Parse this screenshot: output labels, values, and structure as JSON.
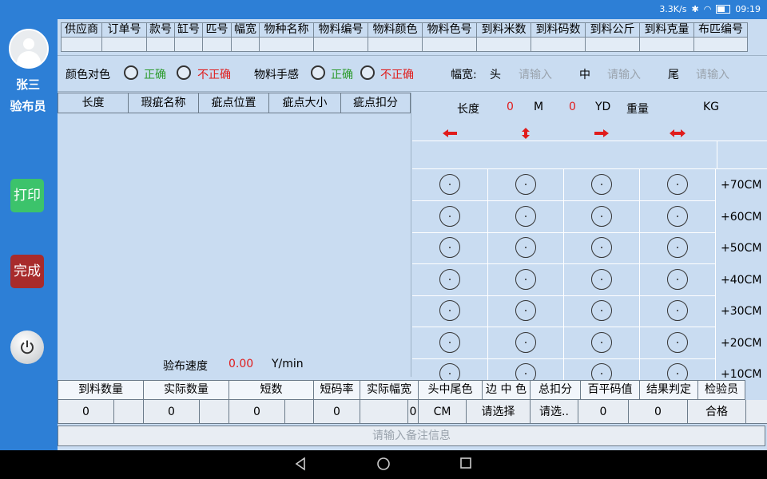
{
  "status": {
    "speed": "3.3K/s",
    "time": "09:19"
  },
  "user": {
    "name": "张三",
    "role": "验布员"
  },
  "sidebar": {
    "print_label": "打印",
    "done_label": "完成"
  },
  "header_columns": [
    "供应商",
    "订单号",
    "款号",
    "缸号",
    "匹号",
    "幅宽",
    "物种名称",
    "物料编号",
    "物料颜色",
    "物料色号",
    "到料米数",
    "到料码数",
    "到料公斤",
    "到料克量",
    "布匹编号"
  ],
  "checks": {
    "color_label": "颜色对色",
    "feel_label": "物料手感",
    "correct": "正确",
    "incorrect": "不正确",
    "width_label": "幅宽:",
    "head": "头",
    "middle": "中",
    "tail": "尾",
    "placeholder": "请输入"
  },
  "defect_table": {
    "columns": [
      "长度",
      "瑕疵名称",
      "疵点位置",
      "疵点大小",
      "疵点扣分"
    ],
    "speed_label": "验布速度",
    "speed_value": "0.00",
    "speed_unit": "Y/min"
  },
  "readout": {
    "length_label": "长度",
    "m_value": "0",
    "m_unit": "M",
    "yd_value": "0",
    "yd_unit": "YD",
    "weight_label": "重量",
    "weight_unit": "KG"
  },
  "grid": {
    "arrows": [
      "left-arrow",
      "up-down-arrow",
      "right-arrow",
      "left-right-arrow"
    ],
    "row_labels": [
      "+70CM",
      "+60CM",
      "+50CM",
      "+40CM",
      "+30CM",
      "+20CM",
      "+10CM"
    ]
  },
  "summary": {
    "columns": [
      "到料数量",
      "实际数量",
      "短数",
      "短码率",
      "实际幅宽",
      "头中尾色",
      "边 中 色",
      "总扣分",
      "百平码值",
      "结果判定",
      "检验员"
    ],
    "values": [
      "0",
      "",
      "0",
      "",
      "0",
      "",
      "0",
      "",
      "0",
      "CM",
      "请选择",
      "请选..",
      "0",
      "0",
      "合格",
      ""
    ],
    "remark_placeholder": "请输入备注信息"
  }
}
